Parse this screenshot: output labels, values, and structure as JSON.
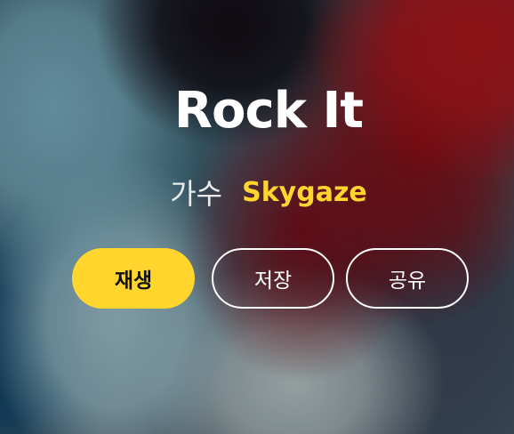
{
  "track": {
    "title": "Rock It",
    "artist_label": "가수",
    "artist_name": "Skygaze"
  },
  "actions": {
    "play_label": "재생",
    "save_label": "저장",
    "share_label": "공유"
  },
  "colors": {
    "accent": "#ffd52e",
    "text": "#ffffff"
  }
}
